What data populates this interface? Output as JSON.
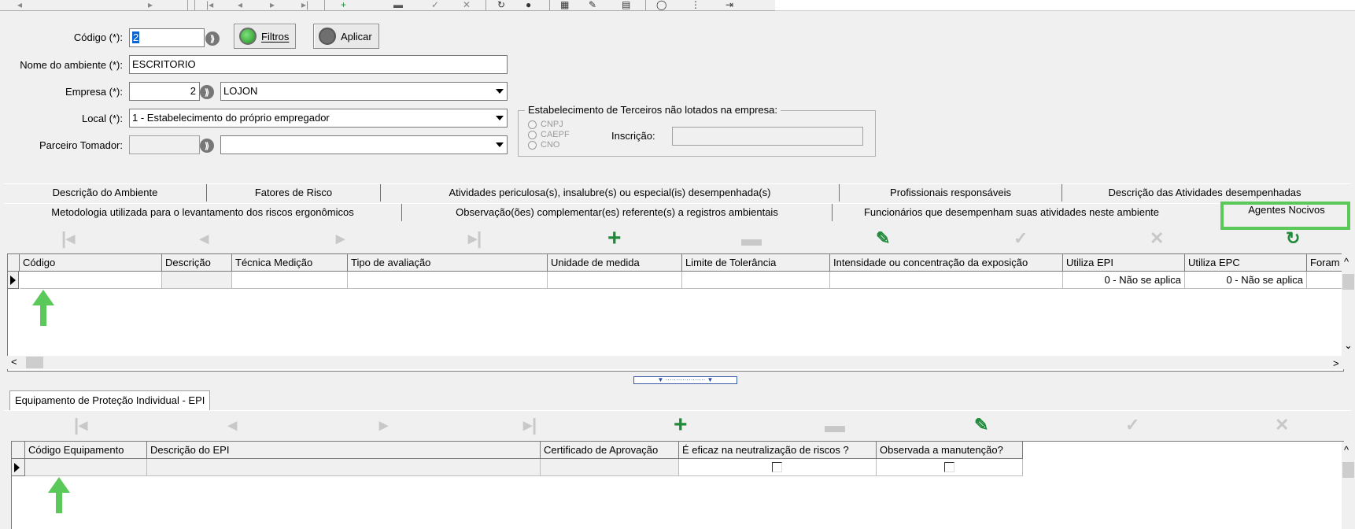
{
  "toolbar_top": {
    "icons": [
      "back-icon",
      "forward-icon",
      "first-icon",
      "prev-icon",
      "next-icon",
      "last-icon",
      "add-icon",
      "delete-icon",
      "post-icon",
      "cancel-icon",
      "refresh-icon",
      "info-icon",
      "calculator-icon",
      "tools-icon",
      "print-icon",
      "help-icon",
      "exit-icon"
    ]
  },
  "form": {
    "codigo_label": "Código (*):",
    "codigo_value": "2",
    "filtros_label": "Filtros",
    "aplicar_label": "Aplicar",
    "nome_label": "Nome do ambiente (*):",
    "nome_value": "ESCRITORIO",
    "empresa_label": "Empresa (*):",
    "empresa_code": "2",
    "empresa_name": "LOJON",
    "local_label": "Local (*):",
    "local_value": "1 - Estabelecimento do próprio empregador",
    "parceiro_label": "Parceiro Tomador:",
    "parceiro_value": "",
    "parceiro_name": ""
  },
  "terceiros": {
    "title": "Estabelecimento de Terceiros não lotados na empresa:",
    "options": [
      "CNPJ",
      "CAEPF",
      "CNO"
    ],
    "inscricao_label": "Inscrição:",
    "inscricao_value": ""
  },
  "tabs_row1": [
    "Descrição do Ambiente",
    "Fatores de Risco",
    "Atividades periculosa(s), insalubre(s) ou especial(is) desempenhada(s)",
    "Profissionais responsáveis",
    "Descrição das Atividades desempenhadas"
  ],
  "tabs_row2": [
    "Metodologia utilizada para o levantamento dos riscos ergonômicos",
    "Observação(ões) complementar(es) referente(s) a registros ambientais",
    "Funcionários que desempenham suas atividades neste ambiente",
    "Agentes Nocivos"
  ],
  "active_tab": "Agentes Nocivos",
  "nav_icons": [
    "first-icon",
    "prev-icon",
    "next-icon",
    "last-icon",
    "add-icon",
    "delete-icon",
    "edit-icon",
    "post-icon",
    "cancel-icon",
    "refresh-icon"
  ],
  "agentes_grid": {
    "columns": [
      "Código",
      "Descrição",
      "Técnica Medição",
      "Tipo de avaliação",
      "Unidade de medida",
      "Limite de Tolerância",
      "Intensidade ou concentração da exposição",
      "Utiliza EPI",
      "Utiliza EPC",
      "Foram"
    ],
    "row": {
      "codigo": "",
      "descricao": "",
      "tecnica": "",
      "tipo": "",
      "unidade": "",
      "limite": "",
      "intensidade": "",
      "utiliza_epi": "0 - Não se aplica",
      "utiliza_epc": "0 - Não se aplica",
      "foram": ""
    }
  },
  "splitter_text": "▼ ··················· ▼",
  "epi_tab": "Equipamento de Proteção Individual - EPI",
  "epi_nav_icons": [
    "first-icon",
    "prev-icon",
    "next-icon",
    "last-icon",
    "add-icon",
    "delete-icon",
    "edit-icon",
    "post-icon",
    "cancel-icon"
  ],
  "epi_grid": {
    "columns": [
      "Código Equipamento",
      "Descrição do EPI",
      "Certificado de Aprovação",
      "É eficaz na neutralização de riscos ?",
      "Observada a manutenção?"
    ],
    "row": {
      "codigo": "",
      "descricao": "",
      "certificado": "",
      "eficaz": false,
      "manutencao": false
    }
  },
  "colors": {
    "annotation_green": "#5ac95a",
    "icon_green": "#1f8a3a"
  }
}
